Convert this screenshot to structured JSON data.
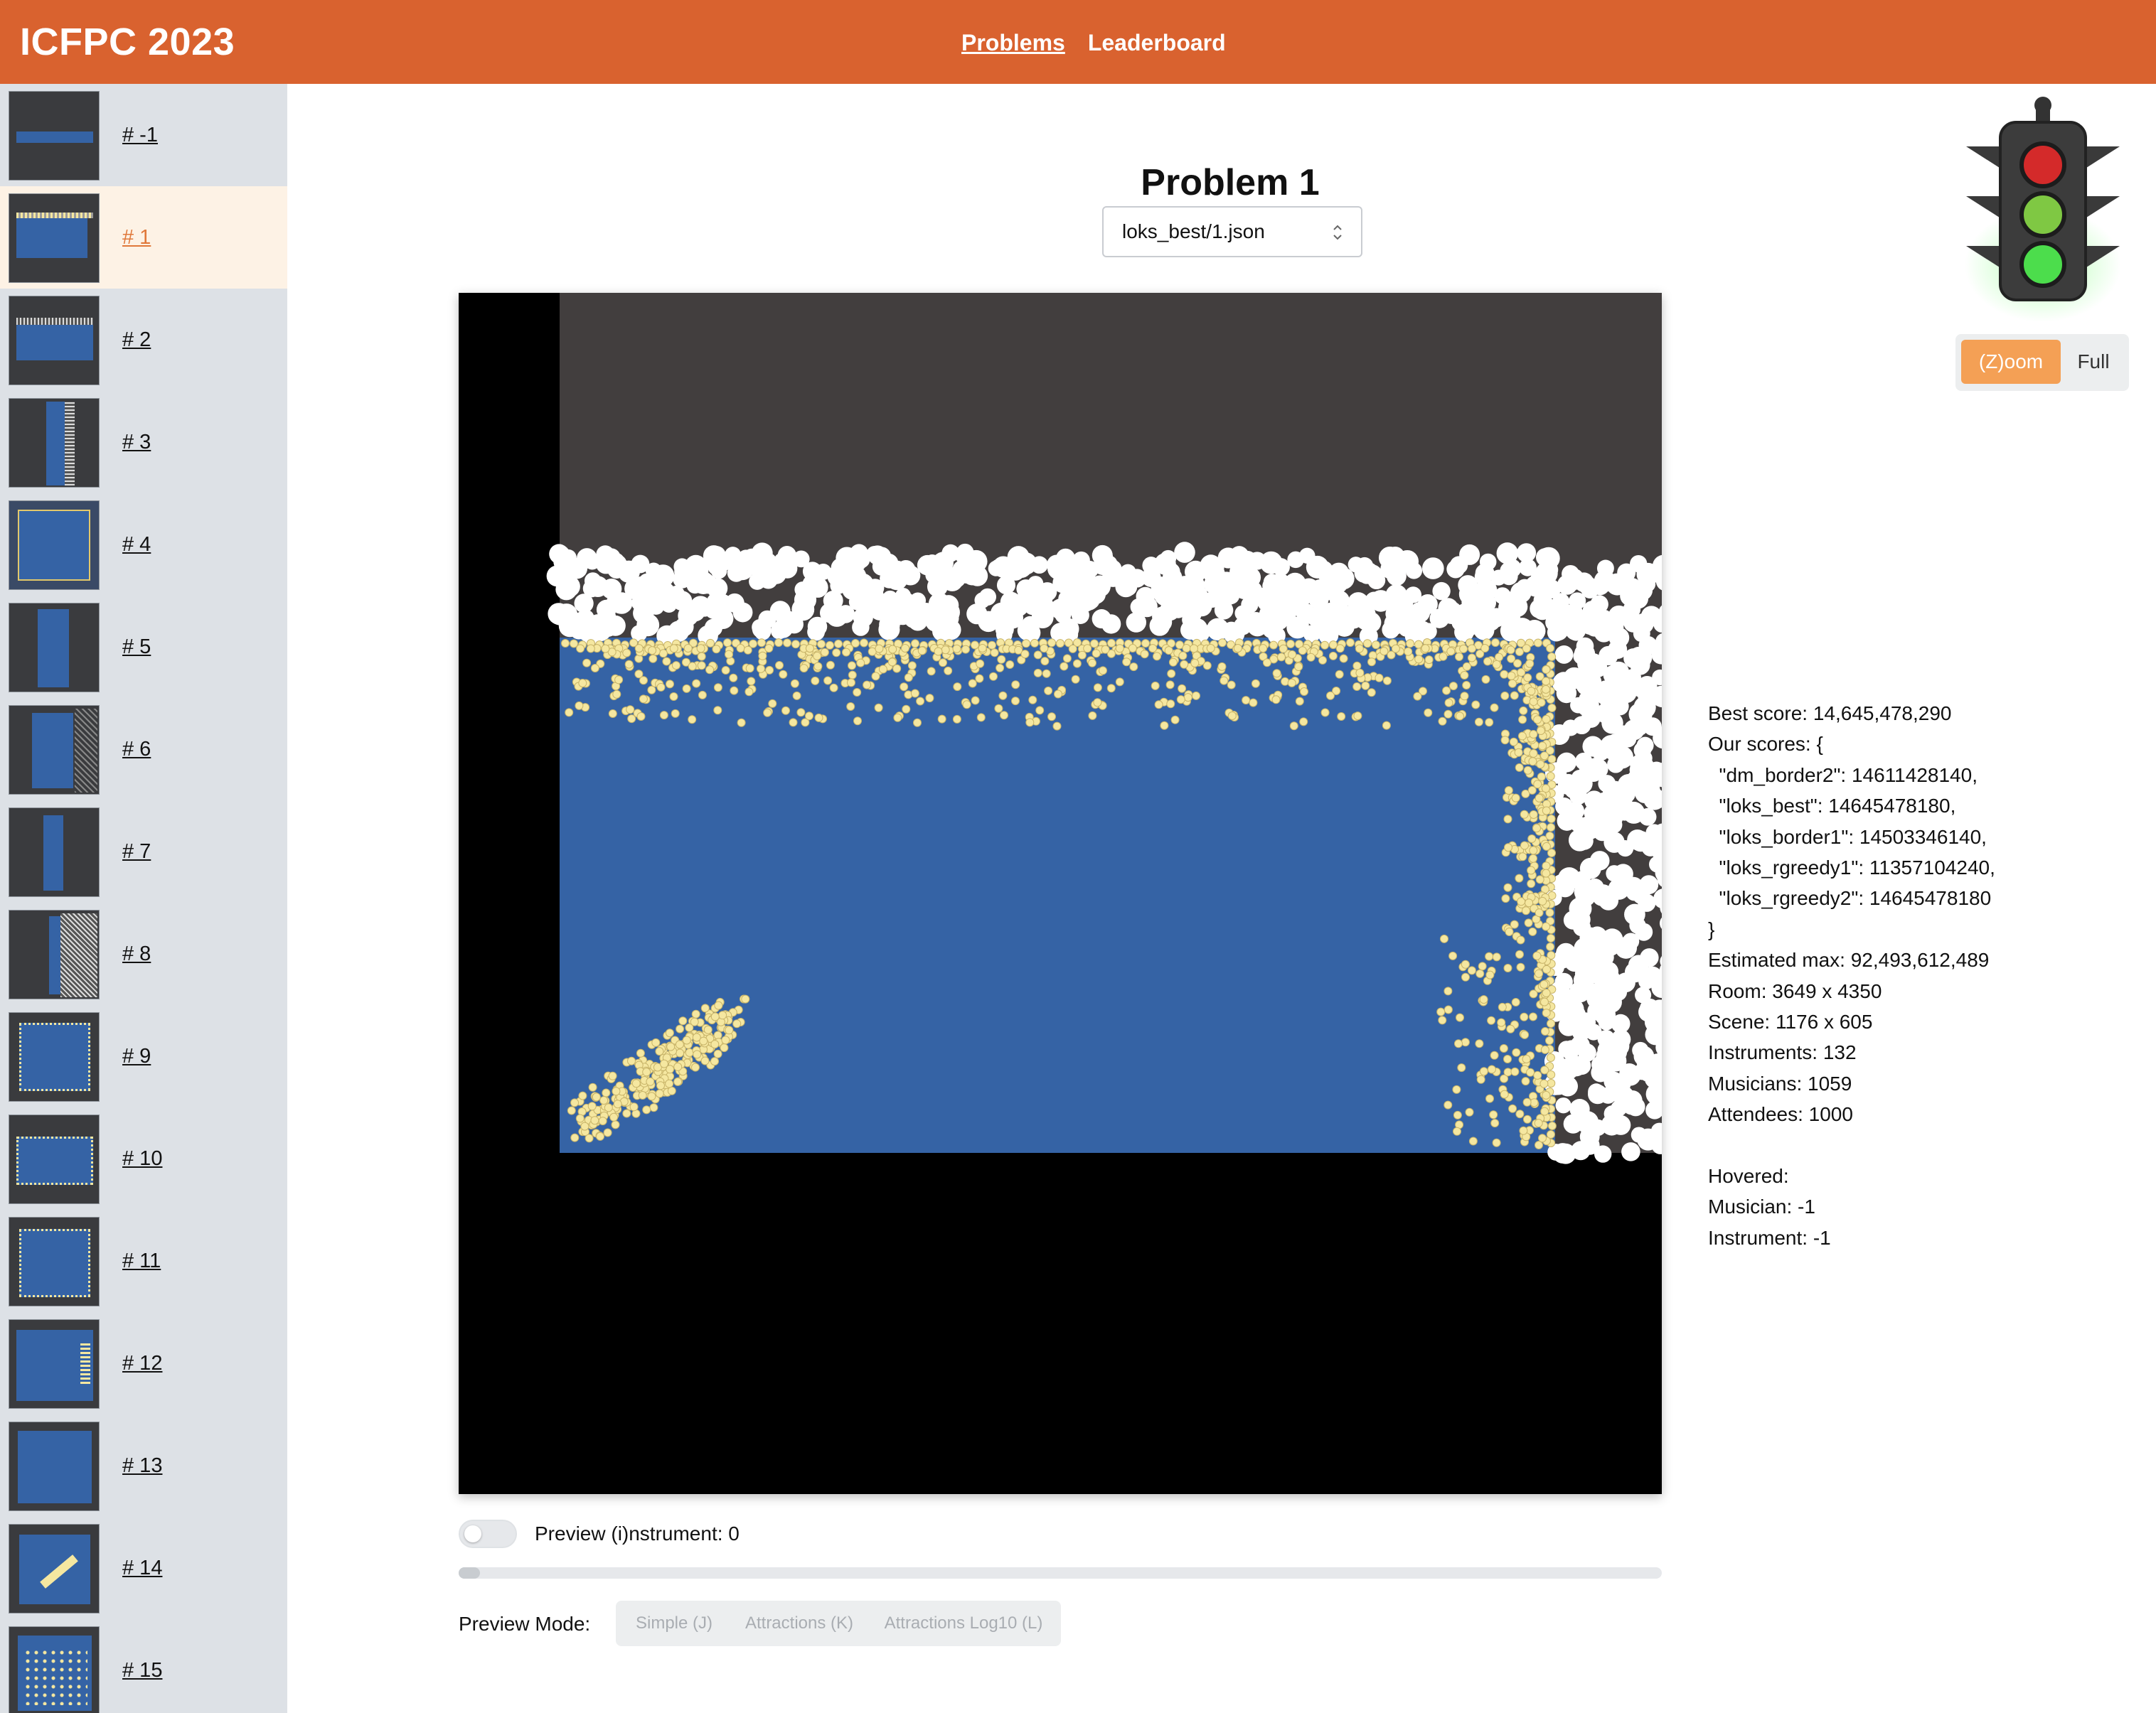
{
  "header": {
    "brand": "ICFPC 2023",
    "nav": {
      "problems": "Problems",
      "leaderboard": "Leaderboard"
    }
  },
  "sidebar": {
    "items": [
      {
        "label": "# -1",
        "selected": false
      },
      {
        "label": "# 1",
        "selected": true
      },
      {
        "label": "# 2",
        "selected": false
      },
      {
        "label": "# 3",
        "selected": false
      },
      {
        "label": "# 4",
        "selected": false
      },
      {
        "label": "# 5",
        "selected": false
      },
      {
        "label": "# 6",
        "selected": false
      },
      {
        "label": "# 7",
        "selected": false
      },
      {
        "label": "# 8",
        "selected": false
      },
      {
        "label": "# 9",
        "selected": false
      },
      {
        "label": "# 10",
        "selected": false
      },
      {
        "label": "# 11",
        "selected": false
      },
      {
        "label": "# 12",
        "selected": false
      },
      {
        "label": "# 13",
        "selected": false
      },
      {
        "label": "# 14",
        "selected": false
      },
      {
        "label": "# 15",
        "selected": false
      }
    ]
  },
  "main": {
    "title": "Problem 1",
    "solution_select": {
      "value": "loks_best/1.json"
    }
  },
  "zoom": {
    "zoom_label": "(Z)oom",
    "full_label": "Full",
    "active": "zoom"
  },
  "info": {
    "best_score": "Best score: 14,645,478,290",
    "our_scores_open": "Our scores: {",
    "scores": [
      "  \"dm_border2\": 14611428140,",
      "  \"loks_best\": 14645478180,",
      "  \"loks_border1\": 14503346140,",
      "  \"loks_rgreedy1\": 11357104240,",
      "  \"loks_rgreedy2\": 14645478180"
    ],
    "our_scores_close": "}",
    "estimated_max": "Estimated max: 92,493,612,489",
    "room": "Room: 3649 x 4350",
    "scene": "Scene: 1176 x 605",
    "instruments": "Instruments: 132",
    "musicians": "Musicians: 1059",
    "attendees": "Attendees: 1000",
    "hovered": "Hovered:",
    "hovered_musician": "Musician: -1",
    "hovered_instrument": "Instrument: -1"
  },
  "controls": {
    "preview_label": "Preview (i)nstrument: 0",
    "preview_instrument_on": false,
    "preview_instrument_value": 0,
    "mode_label": "Preview Mode:",
    "modes": [
      "Simple (J)",
      "Attractions (K)",
      "Attractions Log10 (L)"
    ]
  },
  "colors": {
    "header": "#d9622f",
    "stage": "#3563a5",
    "room": "#423e3e",
    "musician": "#f5e7a0",
    "attendee": "#ffffff",
    "accent": "#f4a055"
  }
}
